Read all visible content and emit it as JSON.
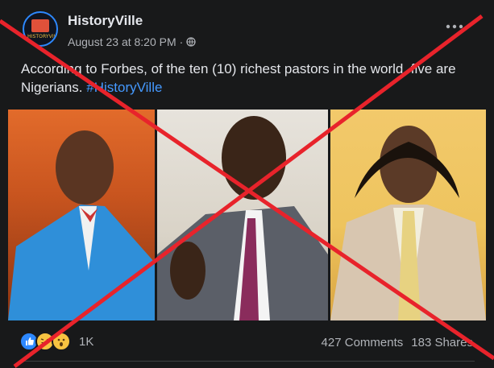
{
  "post": {
    "page_name": "HistoryVille",
    "timestamp": "August 23 at 8:20 PM",
    "separator": "·",
    "privacy_icon": "globe-icon",
    "avatar_logo_text": "HISTORYVILLE",
    "text": "According to Forbes, of the ten (10) richest pastors in the world, five are Nigerians.",
    "hashtag": "#HistoryVille"
  },
  "reactions": {
    "icons": [
      "like-icon",
      "haha-icon",
      "wow-icon"
    ],
    "count": "1K"
  },
  "stats": {
    "comments": "427 Comments",
    "shares": "183 Shares"
  },
  "overlay": {
    "type": "red-cross",
    "color": "#e8232b"
  },
  "colors": {
    "background": "#18191a",
    "text_primary": "#e4e6eb",
    "text_secondary": "#b0b3b8",
    "link": "#4599ff",
    "cross": "#e8232b"
  }
}
